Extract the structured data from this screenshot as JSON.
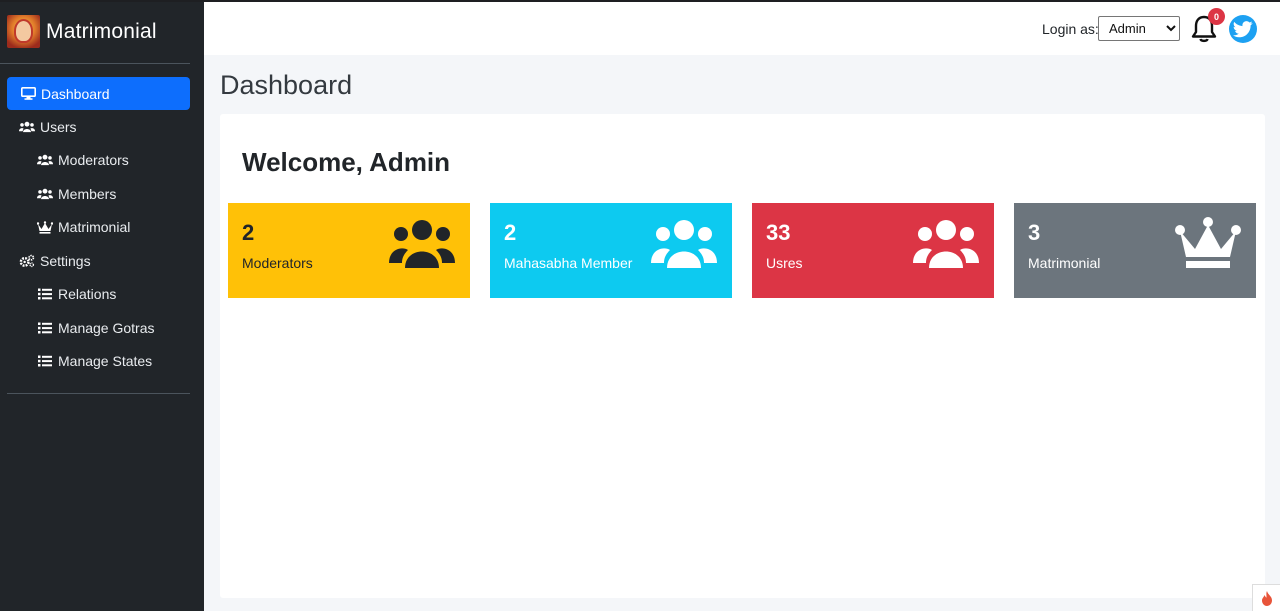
{
  "brand": {
    "name": "Matrimonial",
    "logo_icon": "deity-logo-icon"
  },
  "sidebar": {
    "items": [
      {
        "label": "Dashboard",
        "icon": "desktop-icon",
        "active": true
      },
      {
        "label": "Users",
        "icon": "users-icon"
      },
      {
        "label": "Moderators",
        "icon": "users-icon"
      },
      {
        "label": "Members",
        "icon": "users-icon"
      },
      {
        "label": "Matrimonial",
        "icon": "crown-icon"
      },
      {
        "label": "Settings",
        "icon": "gears-icon"
      },
      {
        "label": "Relations",
        "icon": "list-icon"
      },
      {
        "label": "Manage Gotras",
        "icon": "list-icon"
      },
      {
        "label": "Manage States",
        "icon": "list-icon"
      }
    ]
  },
  "header": {
    "login_label": "Login as:",
    "role_options": [
      "Admin"
    ],
    "selected_role": "Admin",
    "notification_count": "0"
  },
  "page": {
    "title": "Dashboard",
    "welcome": "Welcome, Admin"
  },
  "cards": [
    {
      "count": "2",
      "label": "Moderators",
      "icon": "users-icon",
      "color": "#ffc107"
    },
    {
      "count": "2",
      "label": "Mahasabha Member",
      "icon": "users-icon",
      "color": "#0dcaf0"
    },
    {
      "count": "33",
      "label": "Usres",
      "icon": "users-icon",
      "color": "#dc3545"
    },
    {
      "count": "3",
      "label": "Matrimonial",
      "icon": "crown-icon",
      "color": "#6c757d"
    }
  ],
  "colors": {
    "sidebar_bg": "#212529",
    "active": "#0d6efd",
    "twitter": "#1da1f2"
  }
}
